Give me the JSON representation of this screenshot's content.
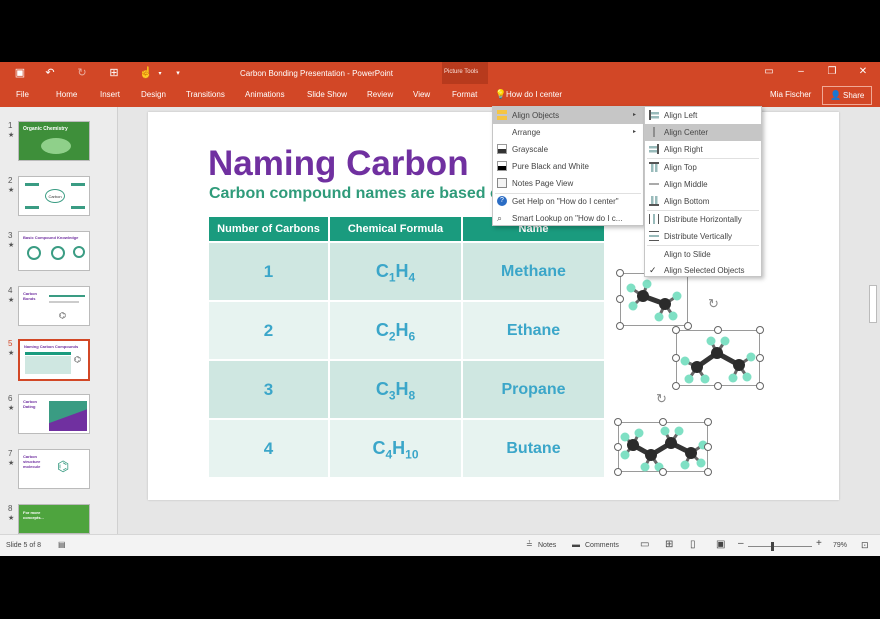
{
  "window": {
    "title": "Carbon Bonding Presentation - PowerPoint",
    "context_group": "Picture Tools",
    "user": "Mia Fischer",
    "share_label": "Share"
  },
  "ribbon": {
    "tabs": [
      "File",
      "Home",
      "Insert",
      "Design",
      "Transitions",
      "Animations",
      "Slide Show",
      "Review",
      "View",
      "Format"
    ],
    "tell_me": "How do I center"
  },
  "thumbnails": [
    {
      "num": "1",
      "title": "Organic Chemistry"
    },
    {
      "num": "2",
      "title": "Carbon"
    },
    {
      "num": "3",
      "title": "Basic Compound Knowledge"
    },
    {
      "num": "4",
      "title": "Carbon Bonds"
    },
    {
      "num": "5",
      "title": "Naming Carbon Compounds"
    },
    {
      "num": "6",
      "title": "Carbon Dating"
    },
    {
      "num": "7",
      "title": "Carbon structure molecule"
    },
    {
      "num": "8",
      "title": "For more concepts..."
    }
  ],
  "slide": {
    "title": "Naming Carbon",
    "subtitle": "Carbon compound names are based on t",
    "table": {
      "headers": [
        "Number of Carbons",
        "Chemical Formula",
        "Name"
      ],
      "rows": [
        {
          "num": "1",
          "c": "C",
          "cs": "1",
          "h": "H",
          "hs": "4",
          "name": "Methane"
        },
        {
          "num": "2",
          "c": "C",
          "cs": "2",
          "h": "H",
          "hs": "6",
          "name": "Ethane"
        },
        {
          "num": "3",
          "c": "C",
          "cs": "3",
          "h": "H",
          "hs": "8",
          "name": "Propane"
        },
        {
          "num": "4",
          "c": "C",
          "cs": "4",
          "h": "H",
          "hs": "10",
          "name": "Butane"
        }
      ]
    }
  },
  "tell_me_menu": [
    {
      "label": "Align Objects",
      "icon": "align-icon",
      "submenu": true,
      "highlighted": true
    },
    {
      "label": "Arrange",
      "icon": "",
      "submenu": true
    },
    {
      "label": "Grayscale",
      "icon": "grayscale-icon"
    },
    {
      "label": "Pure Black and White",
      "icon": "black-white-icon"
    },
    {
      "label": "Notes Page View",
      "icon": "notes-page-icon"
    },
    {
      "label": "Get Help on \"How do I center\"",
      "icon": "help-icon"
    },
    {
      "label": "Smart Lookup on \"How do I c...",
      "icon": "smart-lookup-icon"
    }
  ],
  "align_submenu": [
    {
      "label": "Align Left",
      "icon": "align-left-icon"
    },
    {
      "label": "Align Center",
      "icon": "align-center-icon",
      "highlighted": true
    },
    {
      "label": "Align Right",
      "icon": "align-right-icon"
    },
    {
      "label": "Align Top",
      "icon": "align-top-icon"
    },
    {
      "label": "Align Middle",
      "icon": "align-middle-icon"
    },
    {
      "label": "Align Bottom",
      "icon": "align-bottom-icon"
    },
    {
      "label": "Distribute Horizontally",
      "icon": "distribute-h-icon"
    },
    {
      "label": "Distribute Vertically",
      "icon": "distribute-v-icon"
    },
    {
      "label": "Align to Slide",
      "icon": ""
    },
    {
      "label": "Align Selected Objects",
      "icon": "check-icon",
      "checked": true
    }
  ],
  "status": {
    "slide_info": "Slide 5 of 8",
    "notes": "Notes",
    "comments": "Comments",
    "zoom": "79%"
  },
  "colors": {
    "accent": "#d24726",
    "title_purple": "#7030a0",
    "table_header": "#1a9b7e",
    "cell_text": "#3ba6c9"
  }
}
